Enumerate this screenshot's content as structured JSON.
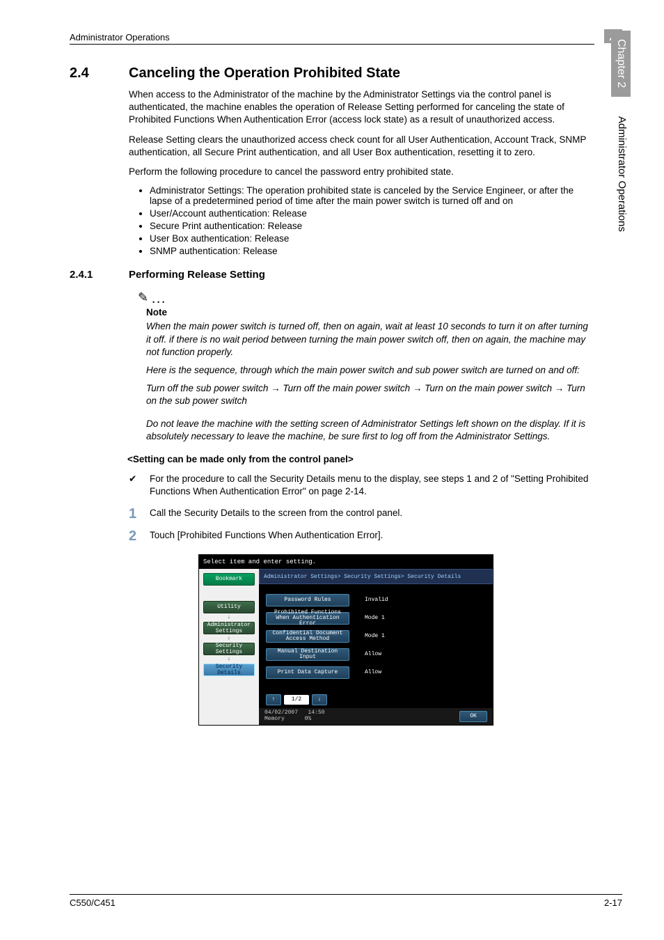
{
  "header": {
    "left": "Administrator Operations",
    "chapter_num": "2"
  },
  "side": {
    "tab": "Chapter 2",
    "text": "Administrator Operations"
  },
  "section": {
    "num": "2.4",
    "title": "Canceling the Operation Prohibited State",
    "p1": "When access to the Administrator of the machine by the Administrator Settings via the control panel is authenticated, the machine enables the operation of Release Setting performed for canceling the state of Prohibited Functions When Authentication Error (access lock state) as a result of unauthorized access.",
    "p2": "Release Setting clears the unauthorized access check count for all User Authentication, Account Track, SNMP authentication, all Secure Print authentication, and all User Box authentication, resetting it to zero.",
    "p3": "Perform the following procedure to cancel the password entry prohibited state.",
    "bullets": [
      "Administrator Settings: The operation prohibited state is canceled by the Service Engineer, or after the lapse of a predetermined period of time after the main power switch is turned off and on",
      "User/Account authentication: Release",
      "Secure Print authentication: Release",
      "User Box authentication: Release",
      "SNMP authentication: Release"
    ]
  },
  "subsection": {
    "num": "2.4.1",
    "title": "Performing Release Setting",
    "note_label": "Note",
    "note_p1": "When the main power switch is turned off, then on again, wait at least 10 seconds to turn it on after turning it off. if there is no wait period between turning the main power switch off, then on again, the machine may not function properly.",
    "note_p2": "Here is the sequence, through which the main power switch and sub power switch are turned on and off:",
    "note_p3": "Turn off the sub power switch → Turn off the main power switch → Turn on the main power switch → Turn on the sub power switch",
    "note_p4": "Do not leave the machine with the setting screen of Administrator Settings left shown on the display. If it is absolutely necessary to leave the machine, be sure first to log off from the Administrator Settings.",
    "sub_head": "<Setting can be made only from the control panel>",
    "check_text": "For the procedure to call the Security Details menu to the display, see steps 1 and 2 of \"Setting Prohibited Functions When Authentication Error\" on page 2-14.",
    "step1": "Call the Security Details to the screen from the control panel.",
    "step2": "Touch [Prohibited Functions When Authentication Error]."
  },
  "panel": {
    "instr": "Select item and enter setting.",
    "bookmark": "Bookmark",
    "crumbs": [
      "Utility",
      "Administrator Settings",
      "Security Settings",
      "Security Details"
    ],
    "breadcrumb": "Administrator Settings> Security Settings> Security Details",
    "options": [
      {
        "label": "Password Rules",
        "value": "Invalid"
      },
      {
        "label": "Prohibited Functions When Authentication Error",
        "value": "Mode 1"
      },
      {
        "label": "Confidential Document Access Method",
        "value": "Mode 1"
      },
      {
        "label": "Manual Destination Input",
        "value": "Allow"
      },
      {
        "label": "Print Data Capture",
        "value": "Allow"
      }
    ],
    "page": "1/2",
    "date": "04/02/2007",
    "time": "14:50",
    "mem_label": "Memory",
    "mem_val": "0%",
    "ok": "OK"
  },
  "footer": {
    "left": "C550/C451",
    "right": "2-17"
  }
}
